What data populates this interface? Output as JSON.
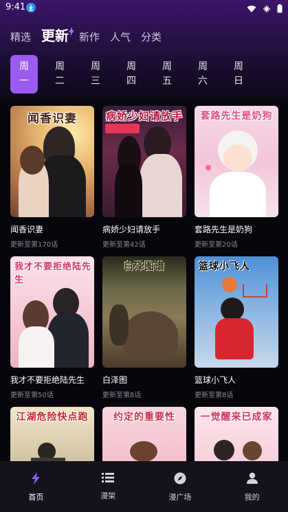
{
  "status_bar": {
    "time": "9:41"
  },
  "top_nav": {
    "tabs": [
      "精选",
      "更新",
      "新作",
      "人气",
      "分类"
    ],
    "active": 1
  },
  "weekdays": [
    {
      "top": "周",
      "bottom": "一"
    },
    {
      "top": "周",
      "bottom": "二"
    },
    {
      "top": "周",
      "bottom": "三"
    },
    {
      "top": "周",
      "bottom": "四"
    },
    {
      "top": "周",
      "bottom": "五"
    },
    {
      "top": "周",
      "bottom": "六"
    },
    {
      "top": "周",
      "bottom": "日"
    }
  ],
  "comics": [
    {
      "cover_text": "闻香识妻",
      "title": "闻香识妻",
      "update": "更新至第170话"
    },
    {
      "cover_text": "病娇少妇请放手",
      "title": "病娇少妇请放手",
      "update": "更新至第42话"
    },
    {
      "cover_text": "套路先生是奶狗",
      "title": "套路先生是奶狗",
      "update": "更新至第20话"
    },
    {
      "cover_text": "我才不要拒绝陆先生",
      "title": "我才不要拒绝陆先生",
      "update": "更新至第50话"
    },
    {
      "cover_text": "白泽图谱",
      "title": "白泽图",
      "update": "更新至第8话"
    },
    {
      "cover_text": "篮球小飞人",
      "title": "篮球小飞人",
      "update": "更新至第8话"
    },
    {
      "cover_text": "江湖危险快点跑",
      "title": "",
      "update": ""
    },
    {
      "cover_text": "约定的重要性",
      "title": "",
      "update": ""
    },
    {
      "cover_text": "一觉醒来已成家",
      "title": "",
      "update": ""
    }
  ],
  "bottom_nav": [
    {
      "label": "首页",
      "icon": "lightning-icon"
    },
    {
      "label": "漫架",
      "icon": "shelf-icon"
    },
    {
      "label": "漫广场",
      "icon": "compass-icon"
    },
    {
      "label": "我的",
      "icon": "user-icon"
    }
  ],
  "colors": {
    "accent": "#9b5bf0",
    "header": "#3a1569",
    "background": "#07060c"
  }
}
